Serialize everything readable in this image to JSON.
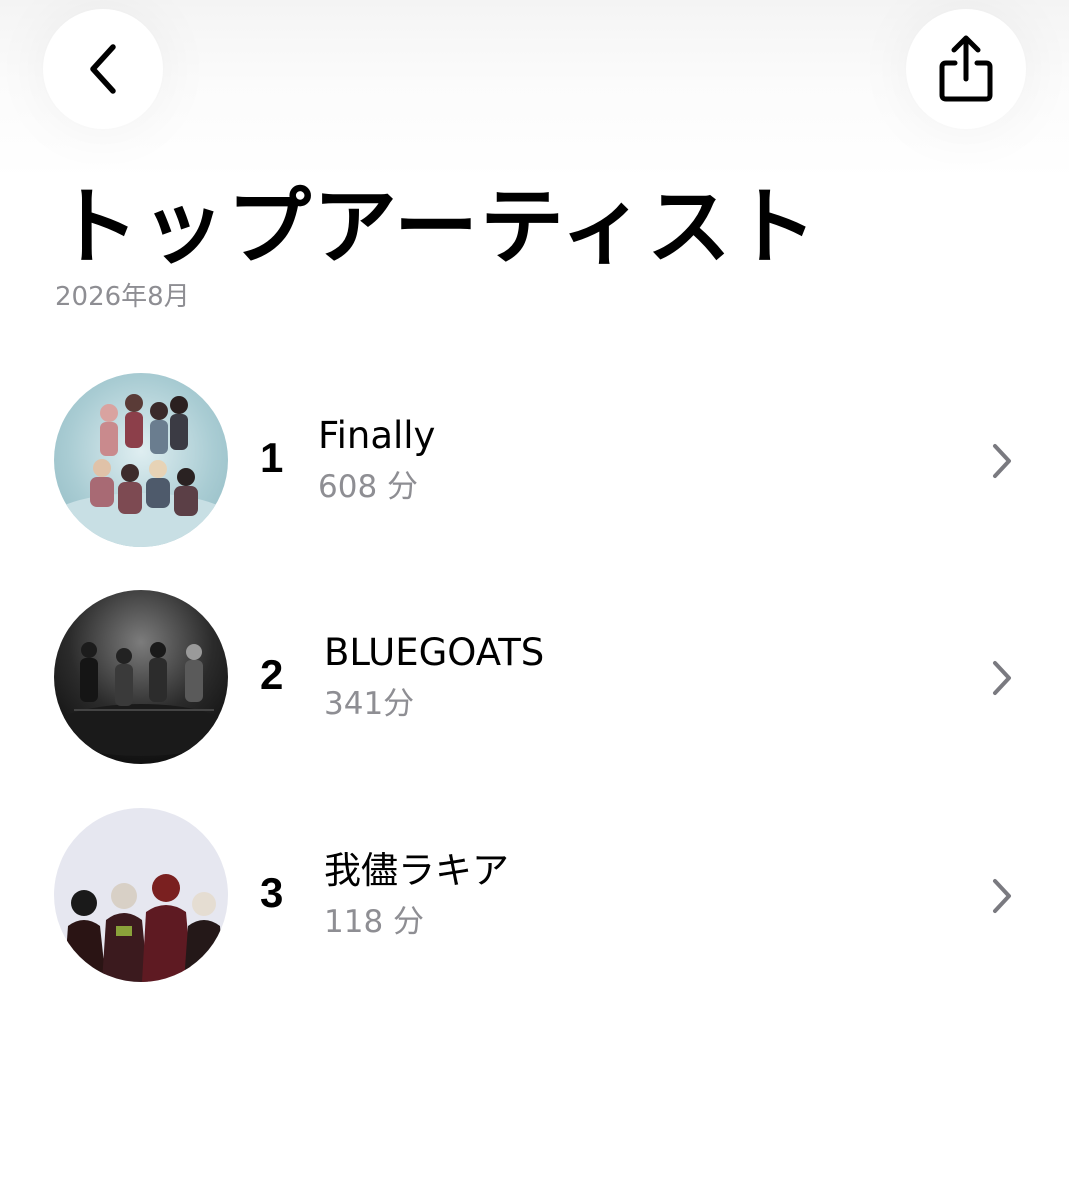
{
  "header": {
    "title": "トップアーティスト",
    "subtitle": "2026年8月",
    "back_icon": "chevron-left-icon",
    "share_icon": "share-icon"
  },
  "artists": [
    {
      "rank": "1",
      "name": "Finally",
      "minutes": "608 分"
    },
    {
      "rank": "2",
      "name": "BLUEGOATS",
      "minutes": "341分"
    },
    {
      "rank": "3",
      "name": "我儘ラキア",
      "minutes": "118 分"
    }
  ],
  "colors": {
    "text_primary": "#000000",
    "text_secondary": "#8e8e93",
    "chevron": "#7a7a80",
    "background": "#ffffff"
  }
}
